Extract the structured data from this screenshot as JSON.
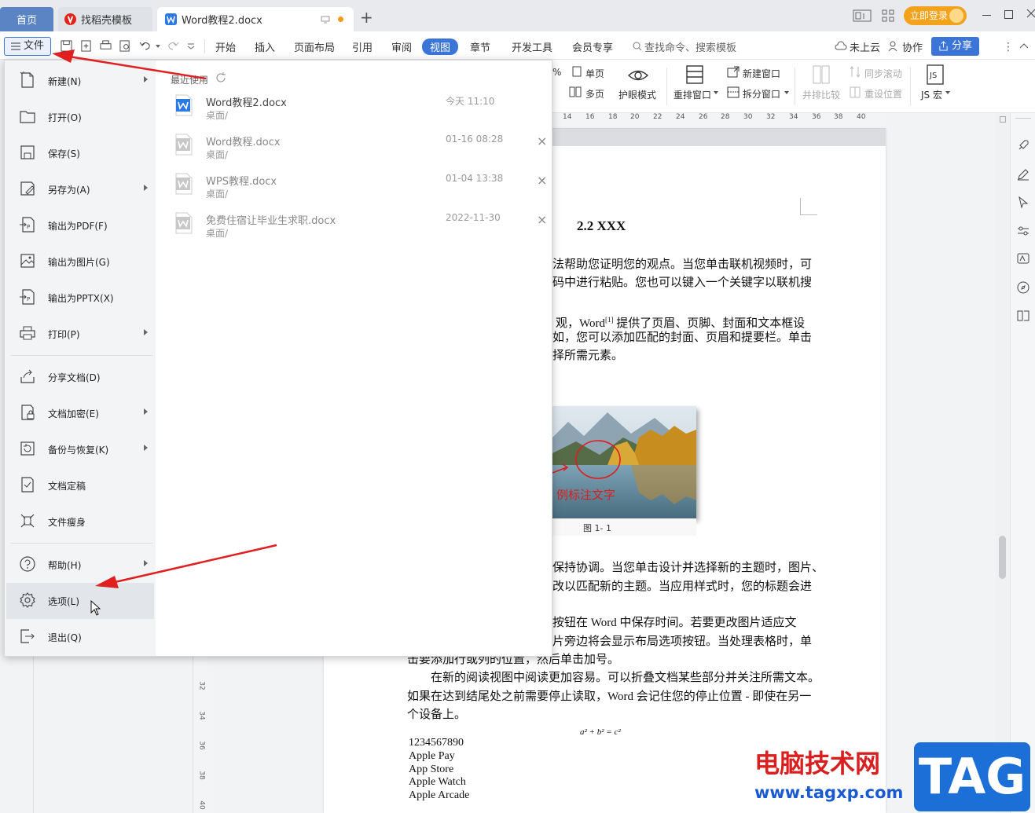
{
  "tabs": {
    "home": "首页",
    "templates": "找稻壳模板",
    "doc": "Word教程2.docx",
    "new_tab": "+"
  },
  "titlebar": {
    "login": "立即登录"
  },
  "menubar": {
    "file": "文件",
    "items": [
      "开始",
      "插入",
      "页面布局",
      "引用",
      "审阅",
      "视图",
      "章节",
      "开发工具",
      "会员专享"
    ],
    "active": "视图",
    "search": "查找命令、搜索模板",
    "cloud": "未上云",
    "collab": "协作",
    "share": "分享"
  },
  "ribbon": {
    "percent": "%",
    "single_page": "单页",
    "multi_page": "多页",
    "eye_mode": "护眼模式",
    "rearrange": "重排窗口",
    "new_window": "新建窗口",
    "split_window": "拆分窗口",
    "compare": "并排比较",
    "sync_scroll": "同步滚动",
    "reset_pos": "重设位置",
    "js_macro": "JS 宏"
  },
  "ruler": {
    "ticks": [
      "14",
      "16",
      "18",
      "20",
      "22",
      "24",
      "26",
      "28",
      "30",
      "32",
      "34",
      "36",
      "38",
      "40"
    ],
    "vticks": [
      "30",
      "32",
      "34",
      "36",
      "38",
      "40"
    ]
  },
  "file_menu": {
    "items": [
      {
        "label": "新建(N)",
        "icon": "new-file-icon",
        "arrow": true
      },
      {
        "label": "打开(O)",
        "icon": "folder-open-icon",
        "arrow": false
      },
      {
        "label": "保存(S)",
        "icon": "save-icon",
        "arrow": false
      },
      {
        "label": "另存为(A)",
        "icon": "save-as-icon",
        "arrow": true
      },
      {
        "label": "输出为PDF(F)",
        "icon": "pdf-export-icon",
        "arrow": false
      },
      {
        "label": "输出为图片(G)",
        "icon": "image-export-icon",
        "arrow": false
      },
      {
        "label": "输出为PPTX(X)",
        "icon": "pptx-export-icon",
        "arrow": false
      },
      {
        "label": "打印(P)",
        "icon": "printer-icon",
        "arrow": true
      },
      {
        "label": "分享文档(D)",
        "icon": "share-icon",
        "arrow": false
      },
      {
        "label": "文档加密(E)",
        "icon": "lock-document-icon",
        "arrow": true
      },
      {
        "label": "备份与恢复(K)",
        "icon": "backup-icon",
        "arrow": true
      },
      {
        "label": "文档定稿",
        "icon": "finalize-icon",
        "arrow": false
      },
      {
        "label": "文件瘦身",
        "icon": "compress-icon",
        "arrow": false
      },
      {
        "label": "帮助(H)",
        "icon": "help-icon",
        "arrow": true
      },
      {
        "label": "选项(L)",
        "icon": "gear-icon",
        "arrow": false
      },
      {
        "label": "退出(Q)",
        "icon": "exit-icon",
        "arrow": false
      }
    ],
    "recent_title": "最近使用",
    "recent": [
      {
        "name": "Word教程2.docx",
        "location": "桌面/",
        "date": "今天  11:10"
      },
      {
        "name": "Word教程.docx",
        "location": "桌面/",
        "date": "01-16 08:28"
      },
      {
        "name": "WPS教程.docx",
        "location": "桌面/",
        "date": "01-04 13:38"
      },
      {
        "name": "免费住宿让毕业生求职.docx",
        "location": "桌面/",
        "date": "2022-11-30"
      }
    ],
    "close_glyph": "×"
  },
  "document": {
    "heading": "2.2 XXX",
    "lines": [
      "法帮助您证明您的观点。当您单击联机视频时，可",
      "码中进行粘贴。您也可以键入一个关键字以联机搜",
      "观，Word",
      "提供了页眉、页脚、封面和文本框设",
      "如，您可以添加匹配的封面、页眉和提要栏。单击",
      "择所需元素。",
      "保持协调。当您单击设计并选择新的主题时，图片、",
      "改以匹配新的主题。当应用样式时，您的标题会进",
      "按钮在  Word  中保存时间。若要更改图片适应文",
      "片旁边将会显示布局选项按钮。当处理表格时，单",
      "击要添加行或列的位置，然后单击加号。",
      "在新的阅读视图中阅读更加容易。可以折叠文档某些部分并关注所需文本。",
      "如果在达到结尾处之前需要停止读取，Word 会记住您的停止位置 - 即使在另一",
      "个设备上。"
    ],
    "footnote_ref": "[1]",
    "image_caption": "图 1- 1",
    "image_annotation": "例标注文字",
    "formula": "a² + b² = c²",
    "list": [
      "1234567890",
      "Apple Pay",
      "App Store",
      "Apple Watch",
      "Apple Arcade"
    ]
  },
  "watermark": {
    "title": "电脑技术网",
    "url": "www.tagxp.com",
    "logo": "TAG"
  },
  "colors": {
    "accent": "#3b75d7",
    "arrow": "#e02020",
    "login": "#f3a21b"
  }
}
